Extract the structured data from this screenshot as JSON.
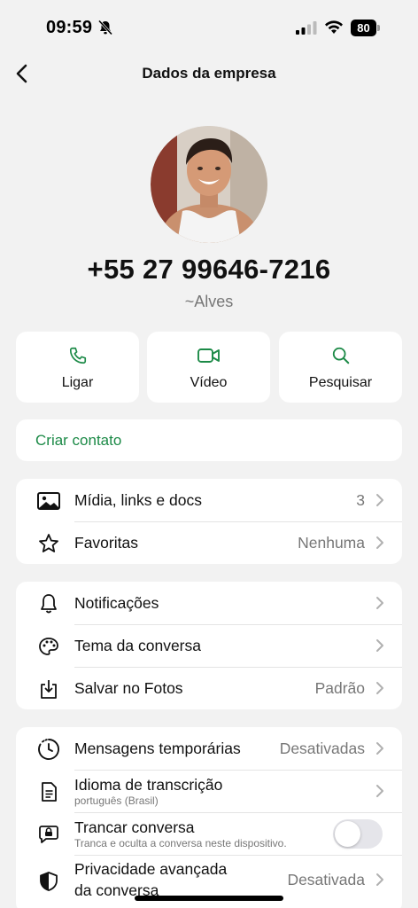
{
  "status_bar": {
    "time": "09:59",
    "battery": "80"
  },
  "nav": {
    "title": "Dados da empresa"
  },
  "profile": {
    "phone": "+55 27 99646-7216",
    "push_name": "~Alves"
  },
  "actions": [
    {
      "label": "Ligar",
      "icon": "phone-icon"
    },
    {
      "label": "Vídeo",
      "icon": "video-icon"
    },
    {
      "label": "Pesquisar",
      "icon": "search-icon"
    }
  ],
  "create_contact": {
    "label": "Criar contato"
  },
  "media_section": [
    {
      "label": "Mídia, links e docs",
      "value": "3",
      "icon": "image-icon"
    },
    {
      "label": "Favoritas",
      "value": "Nenhuma",
      "icon": "star-icon"
    }
  ],
  "settings_section": [
    {
      "label": "Notificações",
      "value": "",
      "icon": "bell-icon"
    },
    {
      "label": "Tema da conversa",
      "value": "",
      "icon": "palette-icon"
    },
    {
      "label": "Salvar no Fotos",
      "value": "Padrão",
      "icon": "download-icon"
    }
  ],
  "privacy_section": [
    {
      "label": "Mensagens temporárias",
      "value": "Desativadas",
      "icon": "timer-icon"
    },
    {
      "label": "Idioma de transcrição",
      "sublabel": "português (Brasil)",
      "icon": "document-icon"
    },
    {
      "label": "Trancar conversa",
      "sublabel": "Tranca e oculta a conversa neste dispositivo.",
      "icon": "chat-lock-icon",
      "toggle": false
    },
    {
      "label": "Privacidade avançada",
      "label2": "da conversa",
      "value": "Desativada",
      "icon": "shield-icon"
    }
  ],
  "colors": {
    "accent": "#1c8a47",
    "background": "#f2f2f2"
  }
}
